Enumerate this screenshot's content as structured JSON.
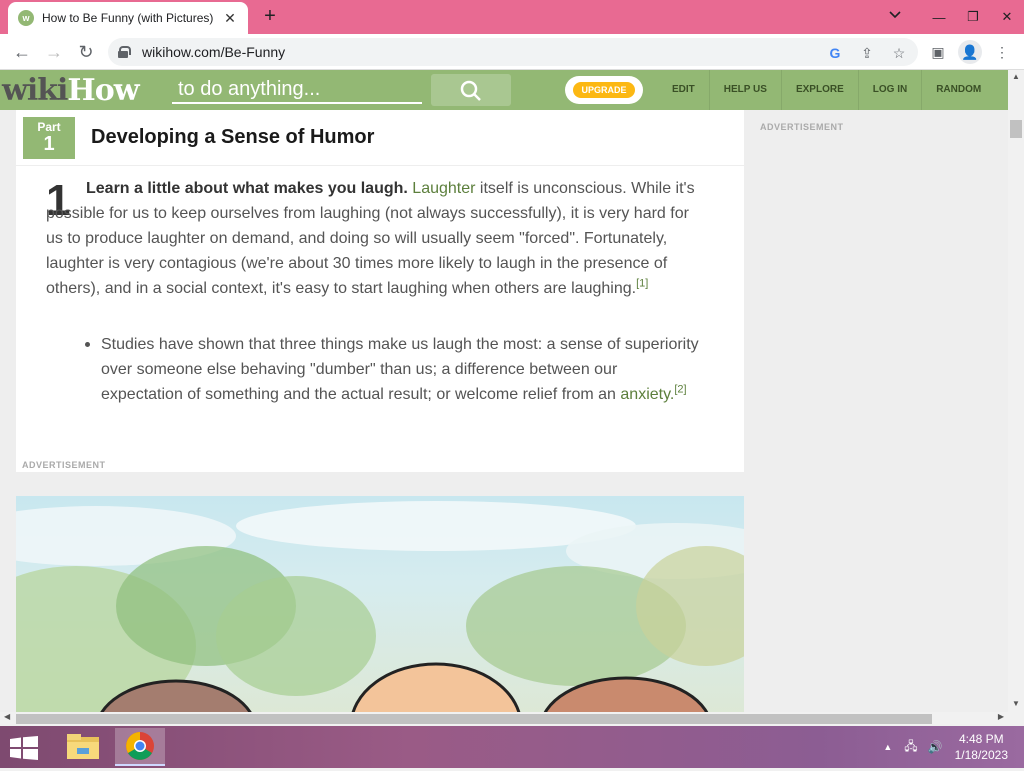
{
  "browser": {
    "tab_title": "How to Be Funny (with Pictures)",
    "url": "wikihow.com/Be-Funny"
  },
  "header": {
    "logo_wiki": "wiki",
    "logo_how": "How",
    "search_placeholder": "to do anything...",
    "upgrade_label": "UPGRADE",
    "nav": [
      "EDIT",
      "HELP US",
      "EXPLORE",
      "LOG IN",
      "RANDOM"
    ]
  },
  "article": {
    "part_label": "Part",
    "part_number": "1",
    "part_title": "Developing a Sense of Humor",
    "step_number": "1",
    "step_bold": "Learn a little about what makes you laugh.",
    "step_link": "Laughter",
    "step_text": " itself is unconscious. While it's possible for us to keep ourselves from laughing (not always successfully), it is very hard for us to produce laughter on demand, and doing so will usually seem \"forced\". Fortunately, laughter is very contagious (we're about 30 times more likely to laugh in the presence of others), and in a social context, it's easy to start laughing when others are laughing.",
    "step_ref": "[1]",
    "bullet_text": "Studies have shown that three things make us laugh the most: a sense of superiority over someone else behaving \"dumber\" than us; a difference between our expectation of something and the actual result; or welcome relief from an ",
    "bullet_link": "anxiety.",
    "bullet_ref": "[2]",
    "ad_label": "ADVERTISEMENT"
  },
  "sidebar": {
    "ad_label": "ADVERTISEMENT"
  },
  "taskbar": {
    "time": "4:48 PM",
    "date": "1/18/2023"
  },
  "colors": {
    "brand_green": "#93b874",
    "tab_bar": "#e86a92"
  }
}
